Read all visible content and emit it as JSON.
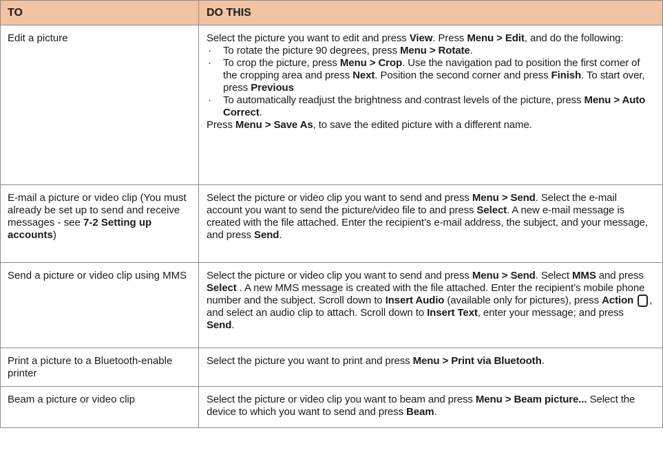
{
  "header": {
    "col_to": "TO",
    "col_do": "DO THIS"
  },
  "rows": [
    {
      "to": "Edit a picture",
      "intro": [
        "Select the picture you want to edit and press ",
        "View",
        ". Press ",
        "Menu > Edit",
        ", and do the following:"
      ],
      "bullets": [
        [
          "To rotate the picture 90 degrees, press ",
          "Menu  > Rotate",
          "."
        ],
        [
          "To crop the picture, press ",
          "Menu > Crop",
          ". Use the navigation pad to position the first corner of the cropping area and press ",
          "Next",
          ". Position the second corner and press ",
          "Finish",
          ". To start over, press ",
          "Previous"
        ],
        [
          "To automatically readjust the brightness and contrast levels of the picture, press ",
          "Menu  > Auto Correct",
          "."
        ]
      ],
      "outro": [
        "Press ",
        "Menu  > Save As",
        ", to save the edited picture with a different name."
      ]
    },
    {
      "to": [
        "E-mail a picture or video clip (You must already be set up to send and receive messages - see ",
        "7-2 Setting up accounts",
        ")"
      ],
      "do": [
        "Select the picture or video clip you want to send and press ",
        "Menu  > Send",
        ". Select the e-mail account you want to send the picture/video file to and press ",
        "Select",
        ". A new e-mail message is created with the file attached. Enter the recipient’s e-mail address, the subject, and your message, and press ",
        "Send",
        "."
      ]
    },
    {
      "to": "Send a picture or video clip using MMS",
      "do": [
        "Select the picture or video clip you want to send and press ",
        "Menu  > Send",
        ". Select ",
        "MMS",
        " and press ",
        "Select",
        " . A new MMS message is created with the file attached. Enter the recipient’s mobile phone number and the subject. Scroll down to ",
        "Insert Audio",
        " (available only for pictures), press ",
        "Action",
        ", and select an audio clip to attach. Scroll down to ",
        "Insert Text",
        ", enter your message; and press ",
        "Send",
        "."
      ]
    },
    {
      "to": "Print a picture to a Bluetooth-enable printer",
      "do": [
        "Select the picture you want to print and press ",
        "Menu  > Print via Bluetooth",
        "."
      ]
    },
    {
      "to": "Beam a picture or video clip",
      "do": [
        "Select the picture or video clip you want to beam and press ",
        "Menu  > Beam picture...",
        " Select the device to which you want to send and press ",
        "Beam",
        "."
      ]
    }
  ],
  "icons": {
    "action": "action-button-icon"
  },
  "colors": {
    "header_bg": "#f2c3a3",
    "border": "#8a8a8a"
  }
}
